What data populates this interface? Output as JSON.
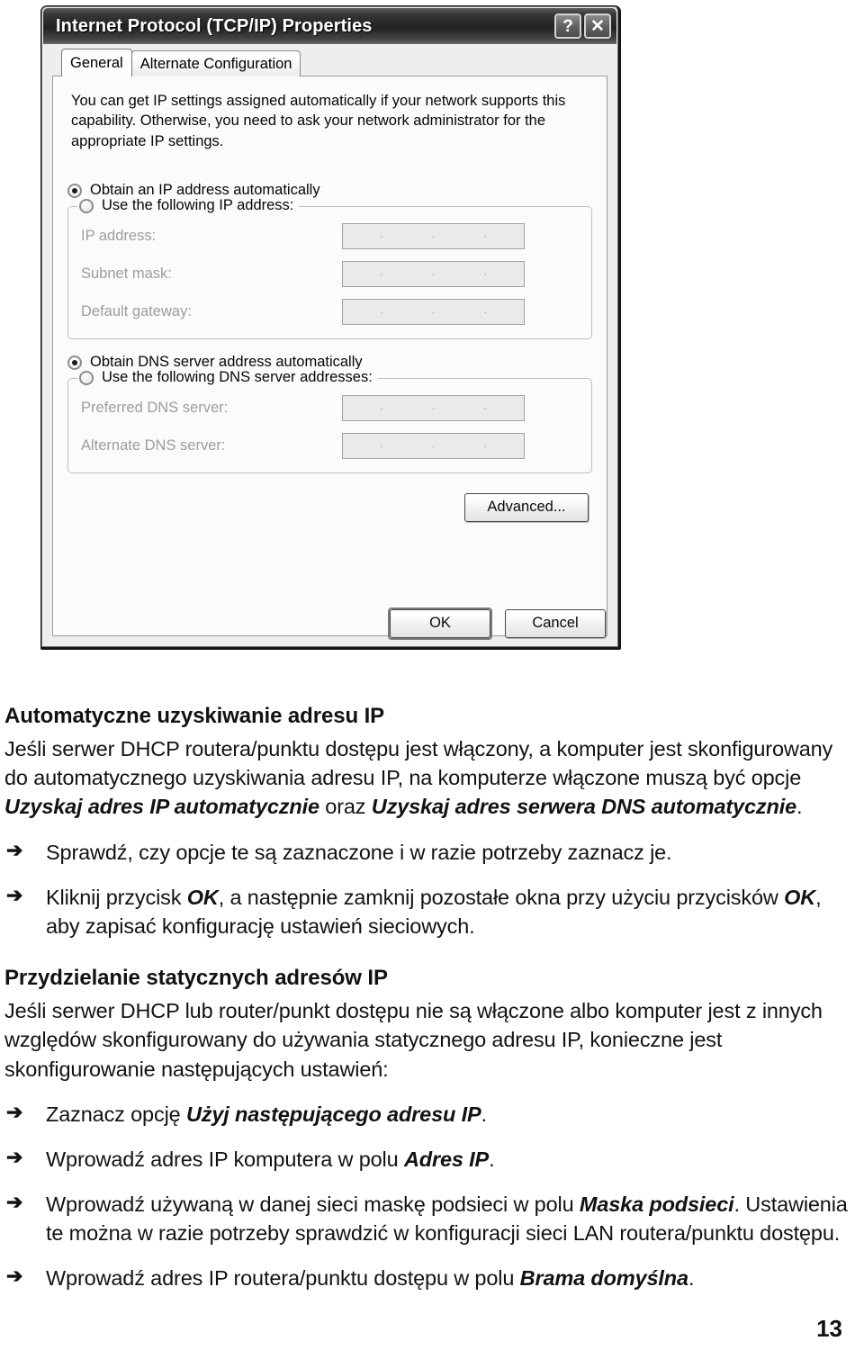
{
  "dialog": {
    "title": "Internet Protocol (TCP/IP) Properties",
    "help_button": "?",
    "close_button": "✕",
    "tabs": [
      {
        "label": "General",
        "active": true
      },
      {
        "label": "Alternate Configuration",
        "active": false
      }
    ],
    "intro_text": "You can get IP settings assigned automatically if your network supports this capability. Otherwise, you need to ask your network administrator for the appropriate IP settings.",
    "ip_options": {
      "auto_label": "Obtain an IP address automatically",
      "auto_selected": true,
      "manual_label": "Use the following IP address:",
      "manual_selected": false,
      "fields": [
        {
          "label": "IP address:",
          "value": ""
        },
        {
          "label": "Subnet mask:",
          "value": ""
        },
        {
          "label": "Default gateway:",
          "value": ""
        }
      ]
    },
    "dns_options": {
      "auto_label": "Obtain DNS server address automatically",
      "auto_selected": true,
      "manual_label": "Use the following DNS server addresses:",
      "manual_selected": false,
      "fields": [
        {
          "label": "Preferred DNS server:",
          "value": ""
        },
        {
          "label": "Alternate DNS server:",
          "value": ""
        }
      ]
    },
    "advanced_button": "Advanced...",
    "ok_button": "OK",
    "cancel_button": "Cancel",
    "separator_dot": "."
  },
  "content": {
    "section1": {
      "title": "Automatyczne uzyskiwanie adresu IP",
      "paragraph_parts": [
        {
          "text": "Jeśli serwer DHCP routera/punktu dostępu jest włączony, a komputer jest skonfigurowany do automatycznego uzyskiwania adresu IP, na komputerze włączone muszą być opcje ",
          "bold": false
        },
        {
          "text": "Uzyskaj adres IP automatycznie",
          "bold": true
        },
        {
          "text": " oraz ",
          "bold": false
        },
        {
          "text": "Uzyskaj adres serwera DNS automatycznie",
          "bold": true
        },
        {
          "text": ".",
          "bold": false
        }
      ],
      "steps": [
        [
          {
            "text": "Sprawdź, czy opcje te są zaznaczone i w razie potrzeby zaznacz je.",
            "bold": false
          }
        ],
        [
          {
            "text": "Kliknij przycisk ",
            "bold": false
          },
          {
            "text": "OK",
            "bold": true
          },
          {
            "text": ", a następnie zamknij pozostałe okna przy użyciu przycisków ",
            "bold": false
          },
          {
            "text": "OK",
            "bold": true
          },
          {
            "text": ", aby zapisać konfigurację ustawień sieciowych.",
            "bold": false
          }
        ]
      ]
    },
    "section2": {
      "title": "Przydzielanie statycznych adresów IP",
      "paragraph_parts": [
        {
          "text": "Jeśli serwer DHCP lub router/punkt dostępu nie są włączone albo komputer jest z innych względów skonfigurowany do używania statycznego adresu IP, konieczne jest skonfigurowanie następujących ustawień:",
          "bold": false
        }
      ],
      "steps": [
        [
          {
            "text": "Zaznacz opcję ",
            "bold": false
          },
          {
            "text": "Użyj następującego adresu IP",
            "bold": true
          },
          {
            "text": ".",
            "bold": false
          }
        ],
        [
          {
            "text": "Wprowadź adres IP komputera w polu ",
            "bold": false
          },
          {
            "text": "Adres IP",
            "bold": true
          },
          {
            "text": ".",
            "bold": false
          }
        ],
        [
          {
            "text": "Wprowadź używaną w danej sieci maskę podsieci w polu ",
            "bold": false
          },
          {
            "text": "Maska podsieci",
            "bold": true
          },
          {
            "text": ". Ustawienia te można w razie potrzeby sprawdzić w konfiguracji sieci LAN routera/punktu dostępu.",
            "bold": false
          }
        ],
        [
          {
            "text": "Wprowadź adres IP routera/punktu dostępu w polu ",
            "bold": false
          },
          {
            "text": "Brama domyślna",
            "bold": true
          },
          {
            "text": ".",
            "bold": false
          }
        ]
      ]
    },
    "bullet_arrow": "➔",
    "page_number": "13"
  }
}
